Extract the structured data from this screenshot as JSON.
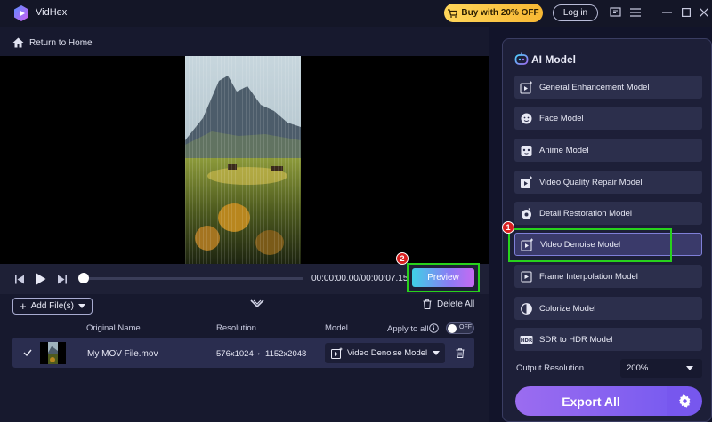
{
  "titlebar": {
    "app_name": "VidHex",
    "buy_label": "Buy with 20% OFF",
    "login_label": "Log in"
  },
  "nav": {
    "return_label": "Return to Home"
  },
  "player": {
    "timecode": "00:00:00.00/00:00:07.15",
    "preview_label": "Preview",
    "progress": 0
  },
  "files": {
    "add_label": "Add File(s)",
    "delete_all_label": "Delete All",
    "columns": {
      "original_name": "Original Name",
      "resolution": "Resolution",
      "model": "Model",
      "apply_to_all": "Apply to all"
    },
    "toggle_state": "OFF",
    "rows": [
      {
        "name": "My MOV File.mov",
        "resolution_from": "576x1024",
        "arrow": "→",
        "resolution_to": "1152x2048",
        "model": "Video Denoise Model"
      }
    ]
  },
  "ai_panel": {
    "title": "AI Model",
    "models": [
      {
        "label": "General Enhancement Model",
        "icon": "enhance-icon"
      },
      {
        "label": "Face Model",
        "icon": "face-icon"
      },
      {
        "label": "Anime Model",
        "icon": "anime-icon"
      },
      {
        "label": "Video Quality Repair Model",
        "icon": "repair-icon"
      },
      {
        "label": "Detail Restoration Model",
        "icon": "detail-icon"
      },
      {
        "label": "Video Denoise Model",
        "icon": "denoise-icon",
        "selected": true
      },
      {
        "label": "Frame Interpolation Model",
        "icon": "interpolation-icon"
      },
      {
        "label": "Colorize Model",
        "icon": "colorize-icon"
      },
      {
        "label": "SDR to HDR Model",
        "icon": "hdr-icon"
      }
    ],
    "output_resolution_label": "Output Resolution",
    "output_resolution_value": "200%",
    "export_label": "Export All"
  },
  "annotations": {
    "step1": "1",
    "step2": "2"
  },
  "colors": {
    "accent": "#8b6cf2",
    "highlight_green": "#28d21c",
    "badge_red": "#d81f1f",
    "buy_gold": "#f7b733"
  }
}
